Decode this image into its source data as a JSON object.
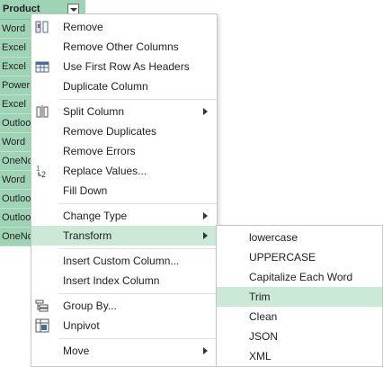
{
  "column": {
    "header": "Product",
    "rows": [
      "Word",
      "Excel",
      "Excel",
      "PowerP",
      "Excel",
      "Outlook",
      "Word",
      "OneNote",
      "Word",
      "Outlook",
      "Outlook",
      "OneNote"
    ]
  },
  "menu": {
    "items": [
      {
        "label": "Remove",
        "icon": "remove-column-icon",
        "submenu": false
      },
      {
        "label": "Remove Other Columns",
        "icon": "",
        "submenu": false
      },
      {
        "label": "Use First Row As Headers",
        "icon": "table-header-icon",
        "submenu": false
      },
      {
        "label": "Duplicate Column",
        "icon": "",
        "submenu": false
      },
      {
        "label": "Split Column",
        "icon": "split-column-icon",
        "submenu": true
      },
      {
        "label": "Remove Duplicates",
        "icon": "",
        "submenu": false
      },
      {
        "label": "Remove Errors",
        "icon": "",
        "submenu": false
      },
      {
        "label": "Replace Values...",
        "icon": "replace-values-icon",
        "submenu": false
      },
      {
        "label": "Fill Down",
        "icon": "",
        "submenu": false
      },
      {
        "label": "Change Type",
        "icon": "",
        "submenu": true
      },
      {
        "label": "Transform",
        "icon": "",
        "submenu": true
      },
      {
        "label": "Insert Custom Column...",
        "icon": "",
        "submenu": false
      },
      {
        "label": "Insert Index Column",
        "icon": "",
        "submenu": false
      },
      {
        "label": "Group By...",
        "icon": "group-by-icon",
        "submenu": false
      },
      {
        "label": "Unpivot",
        "icon": "unpivot-icon",
        "submenu": false
      },
      {
        "label": "Move",
        "icon": "",
        "submenu": true
      }
    ]
  },
  "submenu": {
    "items": [
      "lowercase",
      "UPPERCASE",
      "Capitalize Each Word",
      "Trim",
      "Clean",
      "JSON",
      "XML"
    ]
  },
  "colors": {
    "accent": "#9fd3b6",
    "highlight": "#cce9d8"
  }
}
